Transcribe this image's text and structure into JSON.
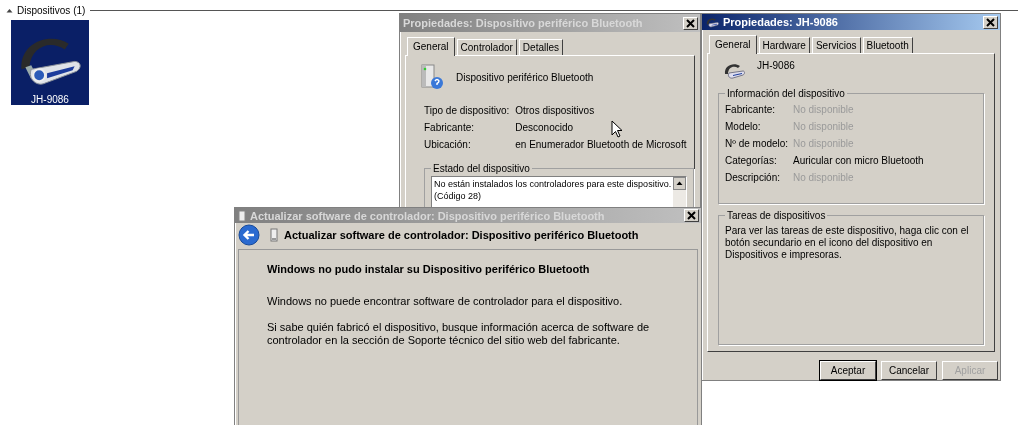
{
  "section": {
    "title": "Dispositivos (1)",
    "expanded": true
  },
  "devices": [
    {
      "name": "JH-9086",
      "selected": true
    }
  ],
  "windows": [
    {
      "kind": "device_properties",
      "title": "Propiedades: Dispositivo periférico Bluetooth",
      "active": false,
      "tabs": [
        {
          "label": "General",
          "selected": true
        },
        {
          "label": "Controlador",
          "selected": false
        },
        {
          "label": "Detalles",
          "selected": false
        }
      ],
      "device_name": "Dispositivo periférico Bluetooth",
      "properties": [
        {
          "label": "Tipo de dispositivo:",
          "value": "Otros dispositivos"
        },
        {
          "label": "Fabricante:",
          "value": "Desconocido"
        },
        {
          "label": "Ubicación:",
          "value": "en Enumerador Bluetooth de Microsoft"
        }
      ],
      "status_group": {
        "title": "Estado del dispositivo",
        "lines": [
          "No están instalados los controladores para este dispositivo.",
          "(Código 28)"
        ]
      }
    },
    {
      "kind": "bluetooth_properties",
      "title": "Propiedades: JH-9086",
      "active": true,
      "tabs": [
        {
          "label": "General",
          "selected": true
        },
        {
          "label": "Hardware",
          "selected": false
        },
        {
          "label": "Servicios",
          "selected": false
        },
        {
          "label": "Bluetooth",
          "selected": false
        }
      ],
      "device_name": "JH-9086",
      "info_group": {
        "title": "Información del dispositivo",
        "rows": [
          {
            "label": "Fabricante:",
            "value": "No disponible",
            "available": false
          },
          {
            "label": "Modelo:",
            "value": "No disponible",
            "available": false
          },
          {
            "label": "Nº de modelo:",
            "value": "No disponible",
            "available": false
          },
          {
            "label": "Categorías:",
            "value": "Auricular con micro Bluetooth",
            "available": true
          },
          {
            "label": "Descripción:",
            "value": "No disponible",
            "available": false
          }
        ]
      },
      "tasks_group": {
        "title": "Tareas de dispositivos",
        "text": "Para ver las tareas de este dispositivo, haga clic con el botón secundario en el icono del dispositivo en Dispositivos e impresoras."
      },
      "buttons": [
        {
          "label": "Aceptar",
          "disabled": false
        },
        {
          "label": "Cancelar",
          "disabled": false
        },
        {
          "label": "Aplicar",
          "disabled": true
        }
      ]
    },
    {
      "kind": "driver_update",
      "title": "Actualizar software de controlador: Dispositivo periférico Bluetooth",
      "active": false,
      "header": "Actualizar software de controlador: Dispositivo periférico Bluetooth",
      "heading": "Windows no pudo instalar su Dispositivo periférico Bluetooth",
      "paragraphs": [
        "Windows no puede encontrar software de controlador para el dispositivo.",
        "Si sabe quién fabricó el dispositivo, busque información acerca de software de controlador en la sección de Soporte técnico del sitio web del fabricante."
      ]
    }
  ]
}
